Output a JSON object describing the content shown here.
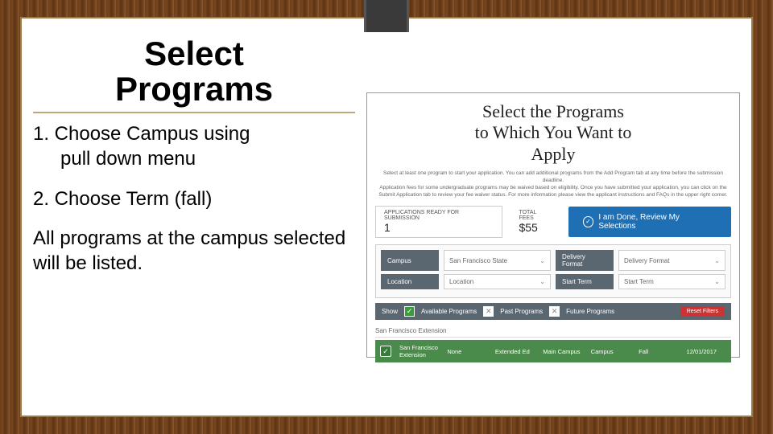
{
  "slide": {
    "title_line1": "Select",
    "title_line2": "Programs",
    "step1_a": "1. Choose Campus using",
    "step1_b": "pull down menu",
    "step2": "2. Choose Term (fall)",
    "note": "All programs at the campus selected will be listed."
  },
  "screenshot": {
    "title_line1": "Select the Programs",
    "title_line2": "to Which You Want to",
    "title_line3": "Apply",
    "intro_line1": "Select at least one program to start your application. You can add additional programs from the Add Program tab at any time before the submission deadline.",
    "intro_line2": "Application fees for some undergraduate programs may be waived based on eligibility. Once you have submitted your application, you can click on the Submit Application tab to review your fee waiver status. For more information please view the applicant instructions and FAQs in the upper right corner.",
    "apps_ready_label": "APPLICATIONS READY FOR SUBMISSION",
    "apps_ready_value": "1",
    "total_fees_label": "TOTAL FEES",
    "total_fees_value": "$55",
    "done_button": "I am Done, Review My Selections",
    "filters": {
      "campus_label": "Campus",
      "campus_value": "San Francisco State",
      "delivery_label": "Delivery Format",
      "delivery_value": "Delivery Format",
      "location_label": "Location",
      "location_value": "Location",
      "start_label": "Start Term",
      "start_value": "Start Term"
    },
    "show_label": "Show",
    "available_label": "Available Programs",
    "past_label": "Past Programs",
    "future_label": "Future Programs",
    "reset_label": "Reset Filters",
    "section_head": "San Francisco Extension",
    "result": {
      "name": "San Francisco Extension",
      "c2": "None",
      "c3": "Extended Ed",
      "c4": "Main Campus",
      "c5": "Campus",
      "c6": "Fall",
      "c7": "12/01/2017"
    }
  }
}
